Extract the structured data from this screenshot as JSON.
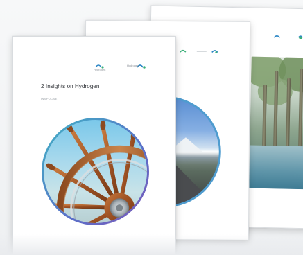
{
  "front_page": {
    "title": "2 Insights on Hydrogen",
    "subtitle": "INSPUCSE",
    "logo_primary": "Hydrogen",
    "logo_secondary": "Hydrogen"
  },
  "colors": {
    "page": "#ffffff",
    "background": "#f4f5f6",
    "logo_blue": "#2b86c5",
    "logo_green": "#3bb07a",
    "circle_border_start": "#3fb4c4",
    "circle_border_end": "#7d58b8"
  },
  "icons": {
    "front_image": "ship-steering-wheel-photo",
    "middle_image": "mountain-road-photo",
    "back_image": "forest-lake-photo",
    "logo": "hydrogen-council-logo-icon"
  }
}
